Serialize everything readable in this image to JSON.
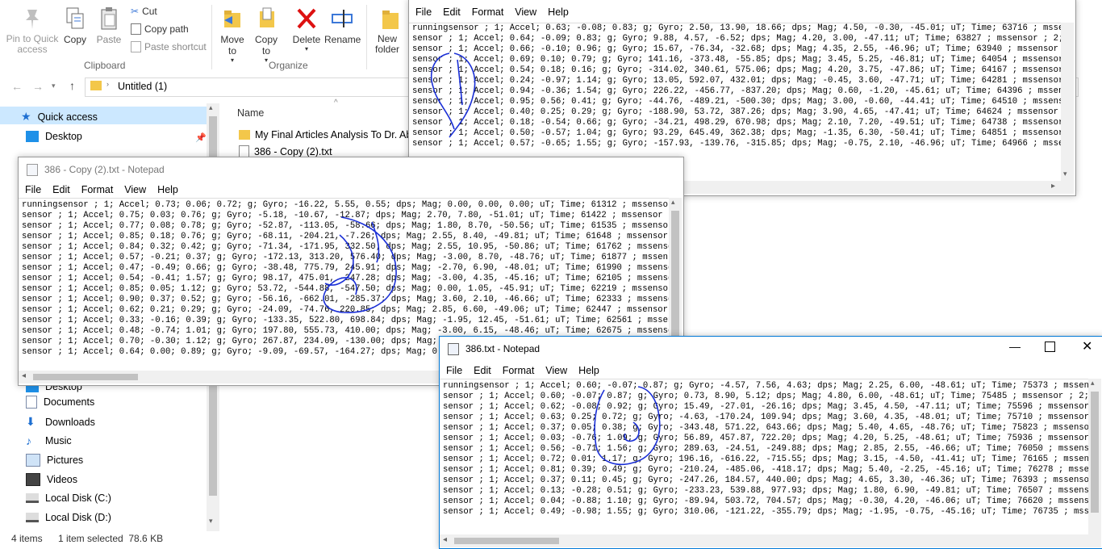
{
  "explorer": {
    "ribbon": {
      "pin_label": "Pin to Quick access",
      "copy_label": "Copy",
      "paste_label": "Paste",
      "cut_label": "Cut",
      "copy_path_label": "Copy path",
      "paste_shortcut_label": "Paste shortcut",
      "clipboard_group": "Clipboard",
      "move_to_label": "Move to",
      "copy_to_label": "Copy to",
      "delete_label": "Delete",
      "rename_label": "Rename",
      "organize_group": "Organize",
      "new_folder_label": "New folder"
    },
    "address": {
      "path": "Untitled (1)"
    },
    "column_name": "Name",
    "files": [
      "My Final Articles Analysis To Dr. Abd",
      "386 - Copy (2).txt"
    ],
    "nav": {
      "quick_access": "Quick access",
      "desktop": "Desktop",
      "downloads_partial": "Downloads",
      "desktop2": "Desktop",
      "documents": "Documents",
      "downloads": "Downloads",
      "music": "Music",
      "pictures": "Pictures",
      "videos": "Videos",
      "local_c": "Local Disk (C:)",
      "local_d": "Local Disk (D:)"
    },
    "status": {
      "items": "4 items",
      "selected": "1 item selected  78.6 KB"
    }
  },
  "notepad_top": {
    "menu": [
      "File",
      "Edit",
      "Format",
      "View",
      "Help"
    ],
    "lines": [
      "runningsensor ; 1; Accel; 0.63; -0.08; 0.83; g; Gyro; 2.50, 13.90, 18.66; dps; Mag; 4.50, -0.30, -45.01; uT; Time; 63716 ; mssensor ; 2;",
      "sensor ; 1; Accel; 0.64; -0.09; 0.83; g; Gyro; 9.88, 4.57, -6.52; dps; Mag; 4.20, 3.00, -47.11; uT; Time; 63827 ; mssensor ; 2; Accel",
      "sensor ; 1; Accel; 0.66; -0.10; 0.96; g; Gyro; 15.67, -76.34, -32.68; dps; Mag; 4.35, 2.55, -46.96; uT; Time; 63940 ; mssensor ; 2; A",
      "sensor ; 1; Accel; 0.69; 0.10; 0.79; g; Gyro; 141.16, -373.48, -55.85; dps; Mag; 3.45, 5.25, -46.81; uT; Time; 64054 ; mssensor ; 2;",
      "sensor ; 1; Accel; 0.54; 0.18; 0.16; g; Gyro; -314.02, 340.61, 575.06; dps; Mag; 4.20, 3.75, -47.86; uT; Time; 64167 ; mssensor ; 2;",
      "sensor ; 1; Accel; 0.24; -0.97; 1.14; g; Gyro; 13.05, 592.07, 432.01; dps; Mag; -0.45, 3.60, -47.71; uT; Time; 64281 ; mssensor ; 2;",
      "sensor ; 1; Accel; 0.94; -0.36; 1.54; g; Gyro; 226.22, -456.77, -837.20; dps; Mag; 0.60, -1.20, -45.61; uT; Time; 64396 ; mssensor ;",
      "sensor ; 1; Accel; 0.95; 0.56; 0.41; g; Gyro; -44.76, -489.21, -500.30; dps; Mag; 3.00, -0.60, -44.41; uT; Time; 64510 ; mssensor ; 2",
      "sensor ; 1; Accel; 0.40; 0.25; 0.29; g; Gyro; -188.90, 53.72, 387.26; dps; Mag; 3.90, 4.65, -47.41; uT; Time; 64624 ; mssensor ; 2; A",
      "sensor ; 1; Accel; 0.18; -0.54; 0.66; g; Gyro; -34.21, 498.29, 670.98; dps; Mag; 2.10, 7.20, -49.51; uT; Time; 64738 ; mssensor ; 2;",
      "sensor ; 1; Accel; 0.50; -0.57; 1.04; g; Gyro; 93.29, 645.49, 362.38; dps; Mag; -1.35, 6.30, -50.41; uT; Time; 64851 ; mssensor ; 2;",
      "sensor ; 1; Accel; 0.57; -0.65; 1.55; g; Gyro; -157.93, -139.76, -315.85; dps; Mag; -0.75, 2.10, -46.96; uT; Time; 64966 ; mssensor ;"
    ]
  },
  "notepad_left": {
    "title": "386 - Copy (2).txt - Notepad",
    "menu": [
      "File",
      "Edit",
      "Format",
      "View",
      "Help"
    ],
    "lines": [
      "runningsensor ; 1; Accel; 0.73; 0.06; 0.72; g; Gyro; -16.22, 5.55, 0.55; dps; Mag; 0.00, 0.00, 0.00; uT; Time; 61312 ; mssensor ; 2;",
      "sensor ; 1; Accel; 0.75; 0.03; 0.76; g; Gyro; -5.18, -10.67, -12.87; dps; Mag; 2.70, 7.80, -51.01; uT; Time; 61422 ; mssensor ; 2; Ac",
      "sensor ; 1; Accel; 0.77; 0.08; 0.78; g; Gyro; -52.87, -113.05, -58.66; dps; Mag; 1.80, 8.70, -50.56; uT; Time; 61535 ; mssensor ; 2;",
      "sensor ; 1; Accel; 0.85; 0.18; 0.76; g; Gyro; -68.11, -204.21, -7.26; dps; Mag; 2.55, 8.40, -49.81; uT; Time; 61648 ; mssensor ; 2; A",
      "sensor ; 1; Accel; 0.84; 0.32; 0.42; g; Gyro; -71.34, -171.95, 332.50; dps; Mag; 2.55, 10.95, -50.86; uT; Time; 61762 ; mssensor ; 2;",
      "sensor ; 1; Accel; 0.57; -0.21; 0.37; g; Gyro; -172.13, 313.20, 576.40; dps; Mag; -3.00, 8.70, -48.76; uT; Time; 61877 ; mssensor ; 2",
      "sensor ; 1; Accel; 0.47; -0.49; 0.66; g; Gyro; -38.48, 775.79, 245.91; dps; Mag; -2.70, 6.90, -48.01; uT; Time; 61990 ; mssensor ; 2;",
      "sensor ; 1; Accel; 0.54; -0.41; 1.57; g; Gyro; 98.17, 475.01, -247.28; dps; Mag; -3.00, 4.35, -45.16; uT; Time; 62105 ; mssensor ; 2;",
      "sensor ; 1; Accel; 0.85; 0.05; 1.12; g; Gyro; 53.72, -544.88, -547.50; dps; Mag; 0.00, 1.05, -45.91; uT; Time; 62219 ; mssensor ; 2;",
      "sensor ; 1; Accel; 0.90; 0.37; 0.52; g; Gyro; -56.16, -662.01, -285.37; dps; Mag; 3.60, 2.10, -46.66; uT; Time; 62333 ; mssensor ; 2;",
      "sensor ; 1; Accel; 0.62; 0.21; 0.29; g; Gyro; -24.09, -74.76, 220.85; dps; Mag; 2.85, 6.60, -49.06; uT; Time; 62447 ; mssensor ; 2; A",
      "sensor ; 1; Accel; 0.33; -0.16; 0.39; g; Gyro; -133.35, 522.80, 698.84; dps; Mag; -1.95, 12.45, -51.61; uT; Time; 62561 ; mssensor ;",
      "sensor ; 1; Accel; 0.48; -0.74; 1.01; g; Gyro; 197.80, 555.73, 410.00; dps; Mag; -3.00, 6.15, -48.46; uT; Time; 62675 ; mssensor ; 2;",
      "sensor ; 1; Accel; 0.70; -0.30; 1.12; g; Gyro; 267.87, 234.09, -130.00; dps; Mag; -3.6",
      "sensor ; 1; Accel; 0.64; 0.00; 0.89; g; Gyro; -9.09, -69.57, -164.27; dps; Mag; 0.30,"
    ]
  },
  "notepad_right": {
    "title": "386.txt - Notepad",
    "menu": [
      "File",
      "Edit",
      "Format",
      "View",
      "Help"
    ],
    "lines": [
      "runningsensor ; 1; Accel; 0.60; -0.07; 0.87; g; Gyro; -4.57, 7.56, 4.63; dps; Mag; 2.25, 6.00, -48.61; uT; Time; 75373 ; mssensor ; 2",
      "sensor ; 1; Accel; 0.60; -0.07; 0.87; g; Gyro; 0.73, 8.90, 5.12; dps; Mag; 4.80, 6.00, -48.61; uT; Time; 75485 ; mssensor ; 2; Accel",
      "sensor ; 1; Accel; 0.62; -0.08; 0.92; g; Gyro; 15.49, -27.01, -26.16; dps; Mag; 3.45, 4.50, -47.11; uT; Time; 75596 ; mssensor ; 2; A",
      "sensor ; 1; Accel; 0.63; 0.25; 0.72; g; Gyro; -4.63, -170.24, 109.94; dps; Mag; 3.60, 4.35, -48.01; uT; Time; 75710 ; mssensor ; 2; A",
      "sensor ; 1; Accel; 0.37; 0.05; 0.38; g; Gyro; -343.48, 571.22, 643.66; dps; Mag; 5.40, 4.65, -48.76; uT; Time; 75823 ; mssensor ; 2;",
      "sensor ; 1; Accel; 0.03; -0.76; 1.09; g; Gyro; 56.89, 457.87, 722.20; dps; Mag; 4.20, 5.25, -48.61; uT; Time; 75936 ; mssensor ; 2; A",
      "sensor ; 1; Accel; 0.56; -0.71; 1.56; g; Gyro; 289.63, -24.51, -249.88; dps; Mag; 2.85, 2.55, -46.66; uT; Time; 76050 ; mssensor ; 2;",
      "sensor ; 1; Accel; 0.72; 0.01; 1.17; g; Gyro; 196.16, -616.22, -715.55; dps; Mag; 3.15, -4.50, -41.41; uT; Time; 76165 ; mssensor ; 2",
      "sensor ; 1; Accel; 0.81; 0.39; 0.49; g; Gyro; -210.24, -485.06, -418.17; dps; Mag; 5.40, -2.25, -45.16; uT; Time; 76278 ; mssensor ;",
      "sensor ; 1; Accel; 0.37; 0.11; 0.45; g; Gyro; -247.26, 184.57, 440.00; dps; Mag; 4.65, 3.30, -46.36; uT; Time; 76393 ; mssensor ; 2;",
      "sensor ; 1; Accel; 0.13; -0.28; 0.51; g; Gyro; -233.23, 539.88, 977.93; dps; Mag; 1.80, 6.90, -49.81; uT; Time; 76507 ; mssensor ; 2;",
      "sensor ; 1; Accel; 0.04; -0.88; 1.10; g; Gyro; -89.94, 503.72, 704.57; dps; Mag; -0.30, 4.20, -46.06; uT; Time; 76620 ; mssensor ; 2;",
      "sensor ; 1; Accel; 0.49; -0.98; 1.55; g; Gyro; 310.06, -121.22, -355.79; dps; Mag; -1.95, -0.75, -45.16; uT; Time; 76735 ; mssensor ;"
    ]
  },
  "colors": {
    "annotation_ink": "#1a2fd6",
    "accent": "#0078d7"
  }
}
